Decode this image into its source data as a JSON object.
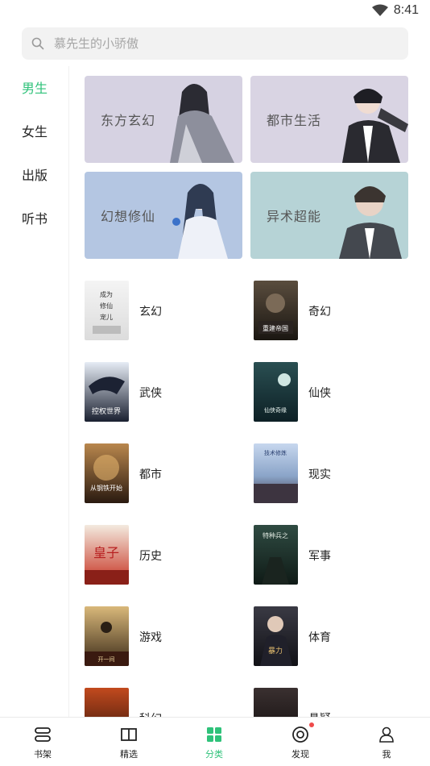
{
  "status": {
    "time": "8:41"
  },
  "search": {
    "placeholder": "慕先生的小骄傲"
  },
  "sidebar": {
    "items": [
      {
        "label": "男生"
      },
      {
        "label": "女生"
      },
      {
        "label": "出版"
      },
      {
        "label": "听书"
      }
    ]
  },
  "banners": [
    {
      "label": "东方玄幻"
    },
    {
      "label": "都市生活"
    },
    {
      "label": "幻想修仙"
    },
    {
      "label": "异术超能"
    }
  ],
  "categories": [
    {
      "name": "玄幻"
    },
    {
      "name": "奇幻"
    },
    {
      "name": "武侠"
    },
    {
      "name": "仙侠"
    },
    {
      "name": "都市"
    },
    {
      "name": "现实"
    },
    {
      "name": "历史"
    },
    {
      "name": "军事"
    },
    {
      "name": "游戏"
    },
    {
      "name": "体育"
    },
    {
      "name": "科幻"
    },
    {
      "name": "悬疑"
    }
  ],
  "tabbar": {
    "tabs": [
      {
        "label": "书架"
      },
      {
        "label": "精选"
      },
      {
        "label": "分类"
      },
      {
        "label": "发现"
      },
      {
        "label": "我"
      }
    ]
  },
  "colors": {
    "accent": "#2fc27a",
    "badge": "#ef4a4a"
  }
}
